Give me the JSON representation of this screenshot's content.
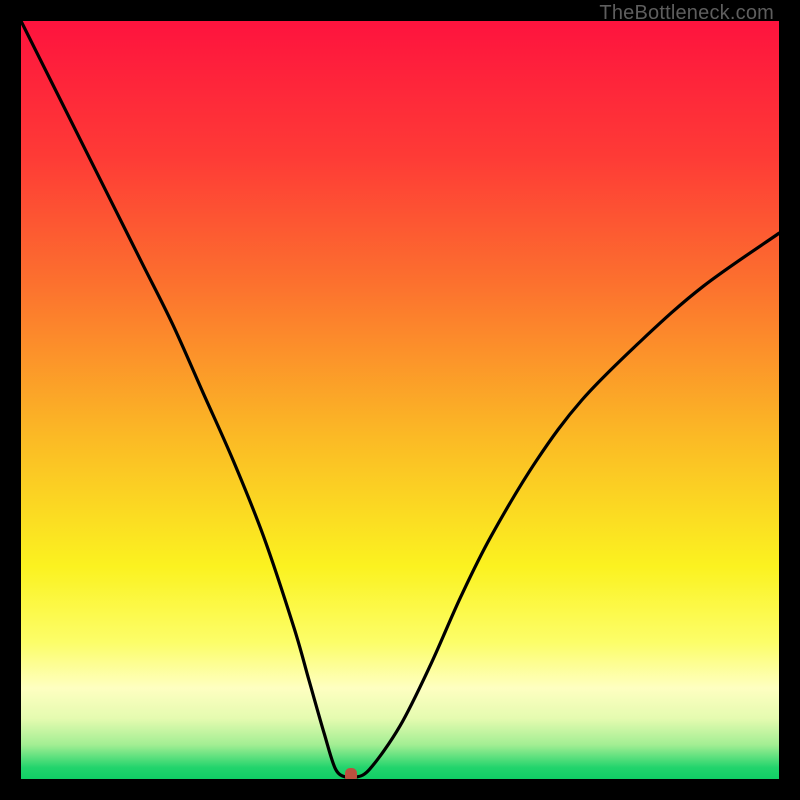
{
  "watermark": "TheBottleneck.com",
  "chart_data": {
    "type": "line",
    "title": "",
    "xlabel": "",
    "ylabel": "",
    "xlim": [
      0,
      100
    ],
    "ylim": [
      0,
      100
    ],
    "series": [
      {
        "name": "bottleneck-curve",
        "x": [
          0,
          4,
          8,
          12,
          16,
          20,
          24,
          28,
          32,
          36,
          38,
          40,
          41.5,
          43,
          44,
          46,
          50,
          54,
          58,
          62,
          68,
          74,
          82,
          90,
          100
        ],
        "y": [
          100,
          92,
          84,
          76,
          68,
          60,
          51,
          42,
          32,
          20,
          13,
          6,
          1.3,
          0.2,
          0.2,
          1.3,
          7,
          15,
          24,
          32,
          42,
          50,
          58,
          65,
          72
        ]
      }
    ],
    "min_marker": {
      "x": 43.5,
      "y": 0.5,
      "color": "#bb503e"
    },
    "gradient_stops": [
      {
        "offset": 0.0,
        "color": "#fe133e"
      },
      {
        "offset": 0.18,
        "color": "#fe3b36"
      },
      {
        "offset": 0.35,
        "color": "#fc722e"
      },
      {
        "offset": 0.55,
        "color": "#fbba25"
      },
      {
        "offset": 0.72,
        "color": "#fbf220"
      },
      {
        "offset": 0.82,
        "color": "#fcfe69"
      },
      {
        "offset": 0.88,
        "color": "#feffc1"
      },
      {
        "offset": 0.92,
        "color": "#e5fbb0"
      },
      {
        "offset": 0.955,
        "color": "#a2ee93"
      },
      {
        "offset": 0.985,
        "color": "#22d46c"
      },
      {
        "offset": 1.0,
        "color": "#10ce65"
      }
    ]
  }
}
